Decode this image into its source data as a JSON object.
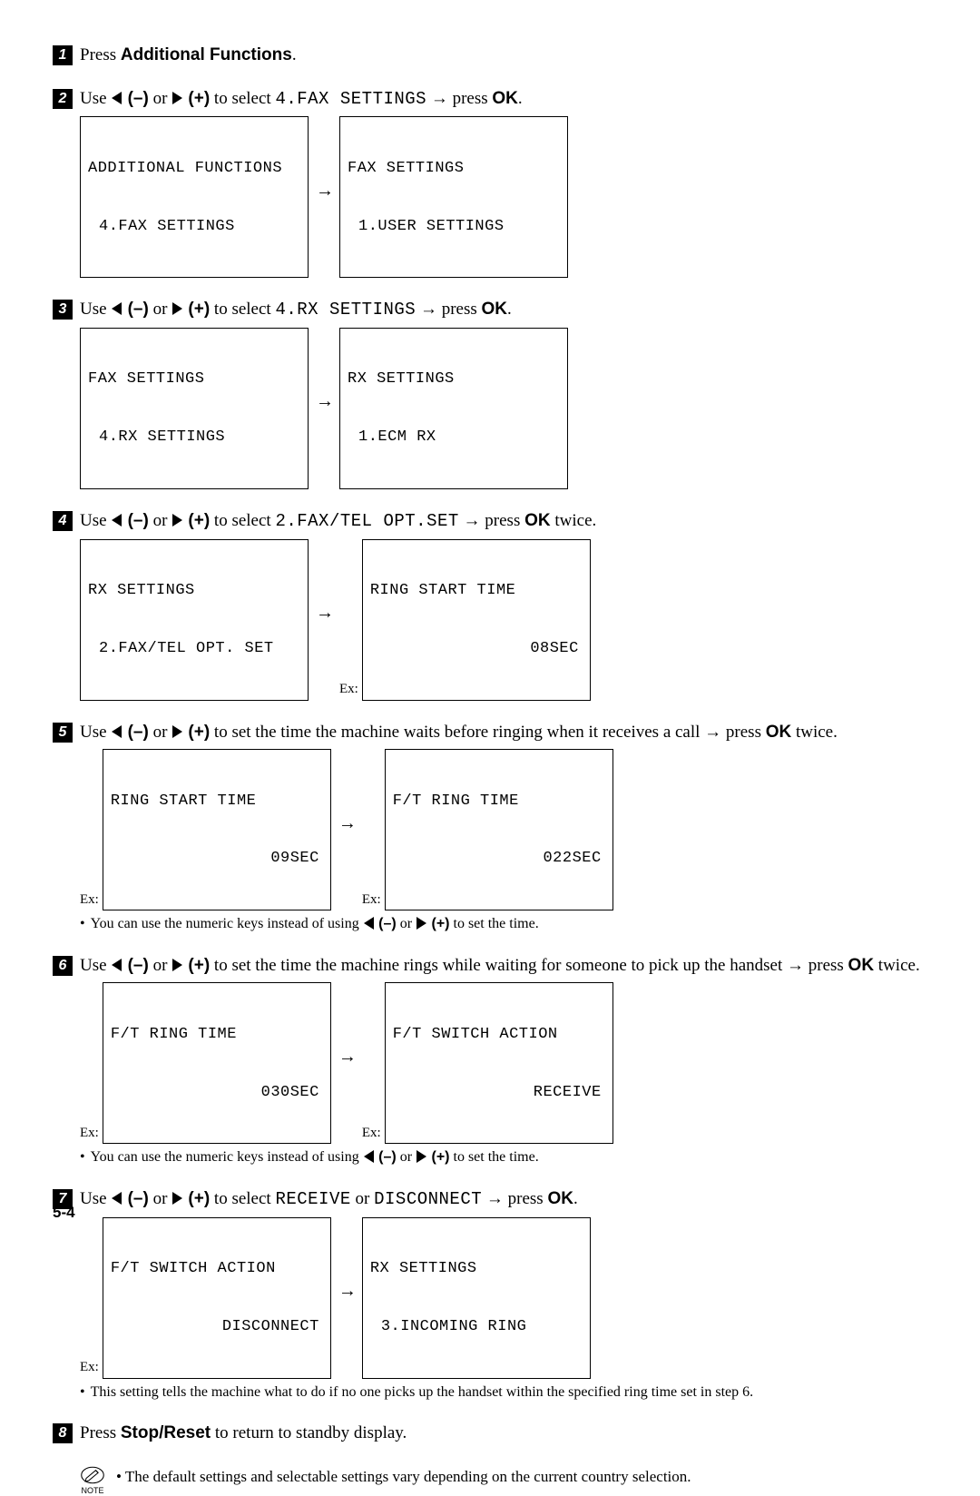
{
  "steps": {
    "s1": {
      "num": "1",
      "text_a": "Press ",
      "text_b": "Additional Functions",
      "text_c": "."
    },
    "s2": {
      "num": "2",
      "pre": "Use ",
      "sel_a": " (–)",
      "or": " or ",
      "sel_b": " (+)",
      "mid": " to select ",
      "menu": "4.FAX SETTINGS",
      "post": " → press ",
      "ok": "OK",
      "end": ".",
      "lcd1": {
        "l1": "ADDITIONAL FUNCTIONS",
        "l2": "4.FAX SETTINGS"
      },
      "lcd2": {
        "l1": "FAX SETTINGS",
        "l2": "1.USER SETTINGS"
      }
    },
    "s3": {
      "num": "3",
      "pre": "Use ",
      "sel_a": " (–)",
      "or": " or ",
      "sel_b": " (+)",
      "mid": " to select ",
      "menu": "4.RX SETTINGS",
      "post": " → press ",
      "ok": "OK",
      "end": ".",
      "lcd1": {
        "l1": "FAX SETTINGS",
        "l2": "4.RX SETTINGS"
      },
      "lcd2": {
        "l1": "RX SETTINGS",
        "l2": "1.ECM RX"
      }
    },
    "s4": {
      "num": "4",
      "pre": "Use ",
      "sel_a": " (–)",
      "or": " or ",
      "sel_b": " (+)",
      "mid": " to select ",
      "menu": "2.FAX/TEL OPT.SET",
      "post": " → press ",
      "ok": "OK",
      "end": " twice.",
      "ex": "Ex:",
      "lcd1": {
        "l1": "RX SETTINGS",
        "l2": "2.FAX/TEL OPT. SET"
      },
      "lcd2": {
        "l1": "RING START TIME",
        "r2": "08SEC"
      }
    },
    "s5": {
      "num": "5",
      "pre": "Use ",
      "sel_a": " (–)",
      "or": " or ",
      "sel_b": " (+)",
      "mid2": " to set the time the machine waits before ringing when it receives a call → press ",
      "ok": "OK",
      "end": " twice.",
      "ex": "Ex:",
      "lcd1": {
        "l1": "RING START TIME",
        "r2": "09SEC"
      },
      "lcd2": {
        "l1": "F/T RING TIME",
        "r2": "022SEC"
      },
      "note": "You can use the numeric keys instead of using ",
      "note_end": " to set the time."
    },
    "s6": {
      "num": "6",
      "pre": "Use ",
      "sel_a": " (–)",
      "or": " or ",
      "sel_b": " (+)",
      "mid2": " to set the time the machine rings while waiting for someone to pick up the handset → press ",
      "ok": "OK",
      "end": " twice.",
      "ex": "Ex:",
      "lcd1": {
        "l1": "F/T RING TIME",
        "r2": "030SEC"
      },
      "lcd2": {
        "l1": "F/T SWITCH ACTION",
        "r2": "RECEIVE"
      },
      "note": "You can use the numeric keys instead of using ",
      "note_end": " to set the time."
    },
    "s7": {
      "num": "7",
      "pre": "Use ",
      "sel_a": " (–)",
      "or": " or ",
      "sel_b": " (+)",
      "mid": " to select ",
      "menu_a": "RECEIVE",
      "or2": " or ",
      "menu_b": "DISCONNECT",
      "post": " → press ",
      "ok": "OK",
      "end": ".",
      "ex": "Ex:",
      "lcd1": {
        "l1": "F/T SWITCH ACTION",
        "r2": "DISCONNECT"
      },
      "lcd2": {
        "l1": "RX SETTINGS",
        "l2": "3.INCOMING RING"
      },
      "note": "This setting tells the machine what to do if no one picks up the handset within the specified ring time set in step 6."
    },
    "s8": {
      "num": "8",
      "text_a": "Press ",
      "text_b": "Stop/Reset",
      "text_c": " to return to standby display."
    }
  },
  "note_label": "NOTE",
  "footnote": "The default settings and selectable settings vary depending on the current country selection.",
  "page_number": "5-4"
}
